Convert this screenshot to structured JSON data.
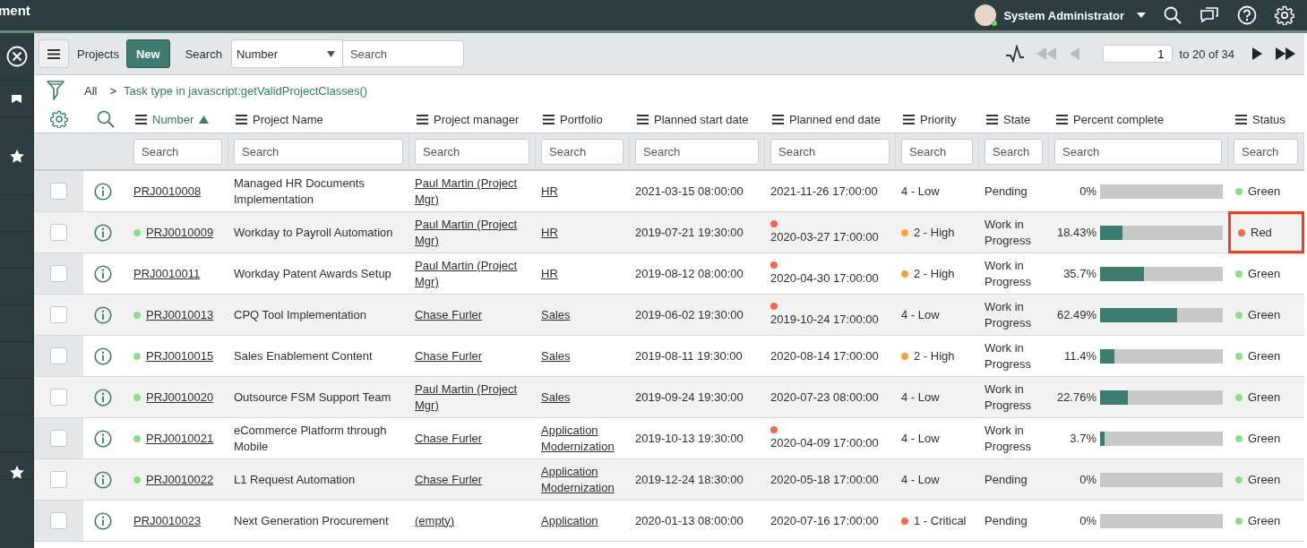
{
  "top_bar": {
    "cut_title": "ment",
    "user": {
      "name": "System Administrator",
      "online": true
    }
  },
  "toolbar": {
    "list_title": "Projects",
    "new_button": "New",
    "search_label": "Search",
    "search_field": "Number",
    "search_placeholder": "Search",
    "page": "1",
    "range": "to 20 of 34",
    "first_disabled": true,
    "prev_disabled": true,
    "next_disabled": false,
    "last_disabled": false
  },
  "breadcrumb": {
    "all": "All",
    "separator": ">",
    "condition": "Task type in javascript:getValidProjectClasses()"
  },
  "columns": [
    {
      "label": "Number",
      "sorted": true,
      "filter_placeholder": "Search"
    },
    {
      "label": "Project Name",
      "sorted": false,
      "filter_placeholder": "Search"
    },
    {
      "label": "Project manager",
      "sorted": false,
      "filter_placeholder": "Search"
    },
    {
      "label": "Portfolio",
      "sorted": false,
      "filter_placeholder": "Search"
    },
    {
      "label": "Planned start date",
      "sorted": false,
      "filter_placeholder": "Search"
    },
    {
      "label": "Planned end date",
      "sorted": false,
      "filter_placeholder": "Search"
    },
    {
      "label": "Priority",
      "sorted": false,
      "filter_placeholder": "Search"
    },
    {
      "label": "State",
      "sorted": false,
      "filter_placeholder": "Search"
    },
    {
      "label": "Percent complete",
      "sorted": false,
      "filter_placeholder": "Search"
    },
    {
      "label": "Status",
      "sorted": false,
      "filter_placeholder": "Search"
    }
  ],
  "rows": [
    {
      "checked": false,
      "number": {
        "text": "PRJ0010008"
      },
      "name": "Managed HR Documents Implementation",
      "manager": "Paul Martin (Project Mgr)",
      "portfolio": "HR",
      "start": "2021-03-15 08:00:00",
      "end": "2021-11-26 17:00:00",
      "end_overdue": false,
      "priority": {
        "text": "4 - Low"
      },
      "state": "Pending",
      "percent": "0%",
      "level": 0,
      "status": {
        "text": "Green",
        "color": "#8edb8e"
      },
      "highlighted": false
    },
    {
      "checked": false,
      "number": {
        "text": "PRJ0010009",
        "color": "#8edb8e"
      },
      "name": "Workday to Payroll Automation",
      "manager": "Paul Martin (Project Mgr)",
      "portfolio": "HR",
      "start": "2019-07-21 19:30:00",
      "end": "2020-03-27 17:00:00",
      "end_overdue": true,
      "priority": {
        "text": "2 - High",
        "color": "#f5a631"
      },
      "state": "Work in Progress",
      "percent": "18.43%",
      "level": 0.1843,
      "status": {
        "text": "Red",
        "color": "#ee6a50"
      },
      "highlighted": true
    },
    {
      "checked": false,
      "number": {
        "text": "PRJ0010011"
      },
      "name": "Workday Patent Awards Setup",
      "manager": "Paul Martin (Project Mgr)",
      "portfolio": "HR",
      "start": "2019-08-12 08:00:00",
      "end": "2020-04-30 17:00:00",
      "end_overdue": true,
      "priority": {
        "text": "2 - High",
        "color": "#f5a631"
      },
      "state": "Work in Progress",
      "percent": "35.7%",
      "level": 0.357,
      "status": {
        "text": "Green",
        "color": "#8edb8e"
      },
      "highlighted": false
    },
    {
      "checked": false,
      "number": {
        "text": "PRJ0010013",
        "color": "#8edb8e"
      },
      "name": "CPQ Tool Implementation",
      "manager": "Chase Furler",
      "portfolio": "Sales",
      "start": "2019-06-02 19:30:00",
      "end": "2019-10-24 17:00:00",
      "end_overdue": true,
      "priority": {
        "text": "4 - Low"
      },
      "state": "Work in Progress",
      "percent": "62.49%",
      "level": 0.6249,
      "status": {
        "text": "Green",
        "color": "#8edb8e"
      },
      "highlighted": false
    },
    {
      "checked": false,
      "number": {
        "text": "PRJ0010015",
        "color": "#8edb8e"
      },
      "name": "Sales Enablement Content",
      "manager": "Chase Furler",
      "portfolio": "Sales",
      "start": "2019-08-11 19:30:00",
      "end": "2020-08-14 17:00:00",
      "end_overdue": false,
      "priority": {
        "text": "2 - High",
        "color": "#f5a631"
      },
      "state": "Work in Progress",
      "percent": "11.4%",
      "level": 0.114,
      "status": {
        "text": "Green",
        "color": "#8edb8e"
      },
      "highlighted": false
    },
    {
      "checked": false,
      "number": {
        "text": "PRJ0010020",
        "color": "#8edb8e"
      },
      "name": "Outsource FSM Support Team",
      "manager": "Paul Martin (Project Mgr)",
      "portfolio": "Sales",
      "start": "2019-09-24 19:30:00",
      "end": "2020-07-23 08:00:00",
      "end_overdue": false,
      "priority": {
        "text": "4 - Low"
      },
      "state": "Work in Progress",
      "percent": "22.76%",
      "level": 0.2276,
      "status": {
        "text": "Green",
        "color": "#8edb8e"
      },
      "highlighted": false
    },
    {
      "checked": false,
      "number": {
        "text": "PRJ0010021",
        "color": "#8edb8e"
      },
      "name": "eCommerce Platform through Mobile",
      "manager": "Chase Furler",
      "portfolio": "Application Modernization",
      "start": "2019-10-13 19:30:00",
      "end": "2020-04-09 17:00:00",
      "end_overdue": true,
      "priority": {
        "text": "4 - Low"
      },
      "state": "Work in Progress",
      "percent": "3.7%",
      "level": 0.037,
      "status": {
        "text": "Green",
        "color": "#8edb8e"
      },
      "highlighted": false
    },
    {
      "checked": false,
      "number": {
        "text": "PRJ0010022",
        "color": "#8edb8e"
      },
      "name": "L1 Request Automation",
      "manager": "Chase Furler",
      "portfolio": "Application Modernization",
      "start": "2019-12-24 18:30:00",
      "end": "2020-05-18 17:00:00",
      "end_overdue": false,
      "priority": {
        "text": "4 - Low"
      },
      "state": "Pending",
      "percent": "0%",
      "level": 0,
      "status": {
        "text": "Green",
        "color": "#8edb8e"
      },
      "highlighted": false
    },
    {
      "checked": false,
      "number": {
        "text": "PRJ0010023"
      },
      "name": "Next Generation Procurement",
      "manager": "(empty)",
      "portfolio": "Application",
      "start": "2020-01-13 08:00:00",
      "end": "2020-07-16 17:00:00",
      "end_overdue": false,
      "priority": {
        "text": "1 - Critical",
        "color": "#ee6a50"
      },
      "state": "Pending",
      "percent": "0%",
      "level": 0,
      "status": {
        "text": "Green",
        "color": "#8edb8e"
      },
      "highlighted": false
    }
  ]
}
